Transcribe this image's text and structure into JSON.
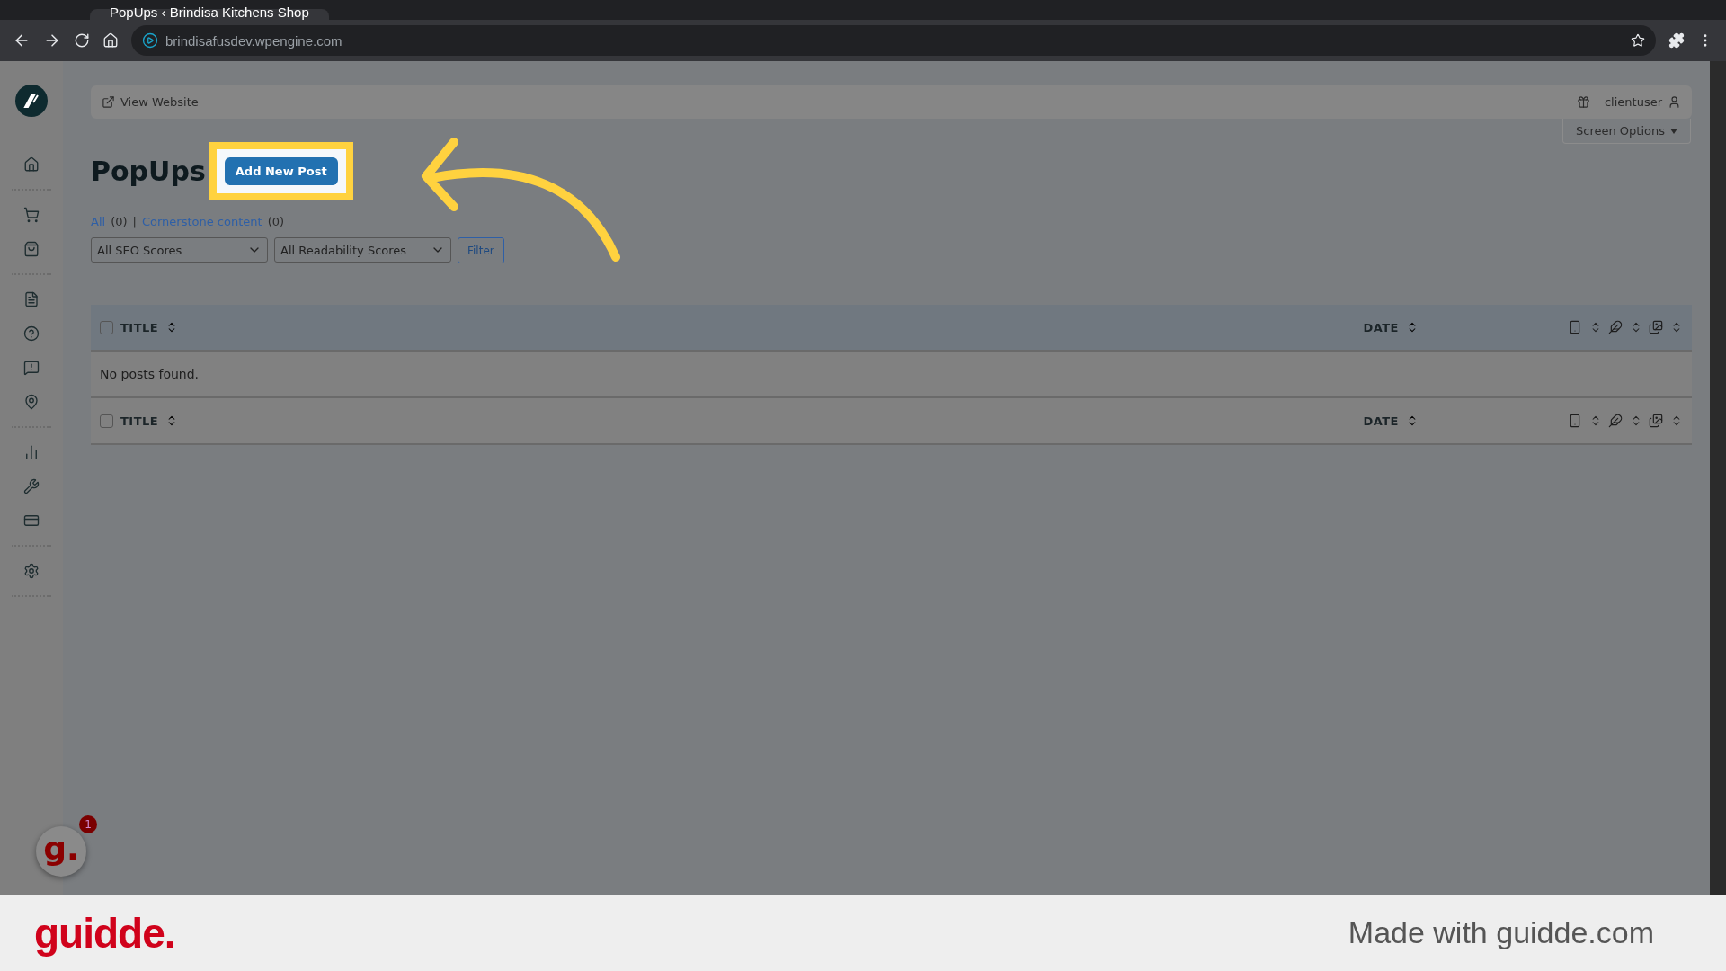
{
  "browser": {
    "tab_title": "PopUps ‹ Brindisa Kitchens Shop",
    "url": "brindisafusdev.wpengine.com"
  },
  "topbar": {
    "view_website": "View Website",
    "user": "clientuser"
  },
  "screen_options": "Screen Options",
  "heading": "PopUps",
  "add_button": "Add New Post",
  "views": [
    {
      "label": "All",
      "count": "(0)"
    },
    {
      "label": "Cornerstone content",
      "count": "(0)"
    }
  ],
  "views_separator": "|",
  "selects": [
    "All SEO Scores",
    "All Readability Scores"
  ],
  "filter_button": "Filter",
  "table": {
    "header": {
      "title": "TITLE",
      "date": "DATE",
      "checked": false
    },
    "empty_message": "No posts found.",
    "footer": {
      "title": "TITLE",
      "date": "DATE",
      "checked": false
    }
  },
  "helper_badge": {
    "logo": "g.",
    "count": "1"
  },
  "footer": {
    "logo": "guidde.",
    "tagline": "Made with guidde.com"
  }
}
